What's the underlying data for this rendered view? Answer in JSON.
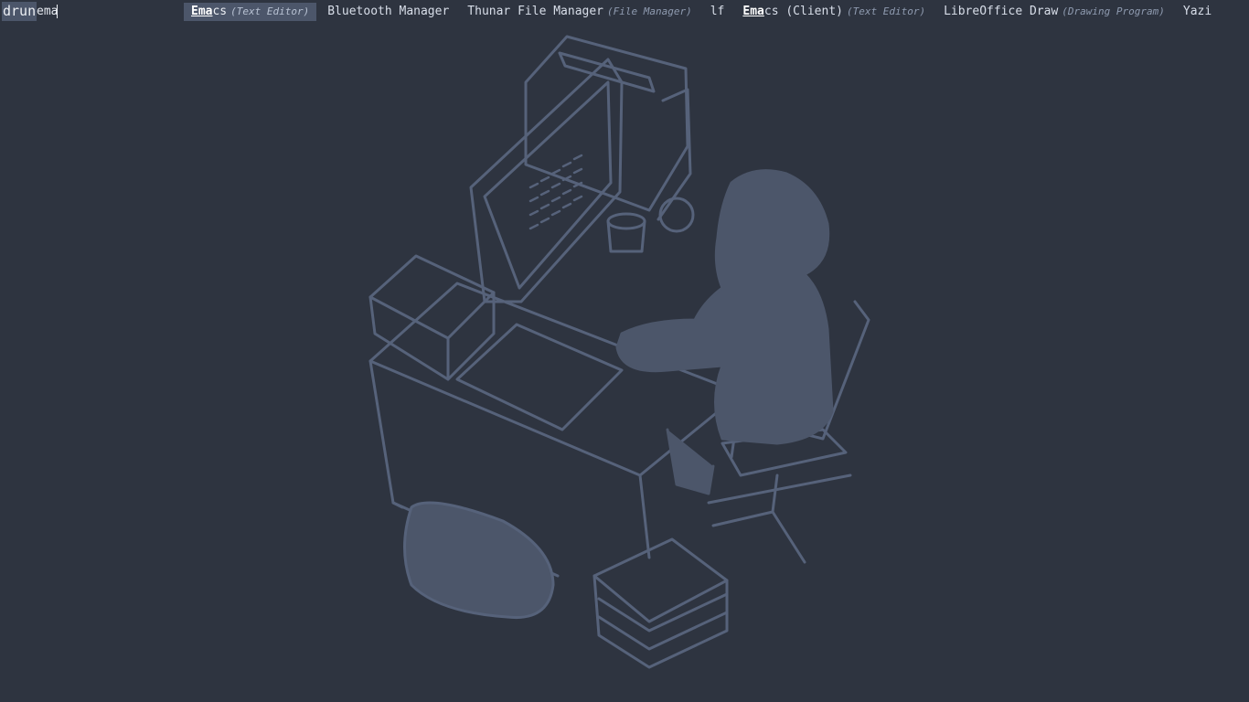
{
  "launcher": {
    "mode": "drun",
    "query": "ema",
    "entries": [
      {
        "match": "Ema",
        "rest": "cs",
        "desc": "(Text Editor)",
        "selected": true
      },
      {
        "match": "",
        "rest": "Bluetooth Manager",
        "desc": "",
        "selected": false
      },
      {
        "match": "",
        "rest": "Thunar File Manager",
        "desc": "(File Manager)",
        "selected": false
      },
      {
        "match": "",
        "rest": "lf",
        "desc": "",
        "selected": false
      },
      {
        "match": "Ema",
        "rest": "cs (Client)",
        "desc": "(Text Editor)",
        "selected": false
      },
      {
        "match": "",
        "rest": "LibreOffice Draw",
        "desc": "(Drawing Program)",
        "selected": false
      },
      {
        "match": "",
        "rest": "Yazi",
        "desc": "",
        "selected": false
      }
    ]
  },
  "colors": {
    "background": "#2e3440",
    "selection": "#4c566a",
    "text": "#d8dee9",
    "wallpaper_line": "#56627a",
    "wallpaper_fill": "#4c566a"
  }
}
